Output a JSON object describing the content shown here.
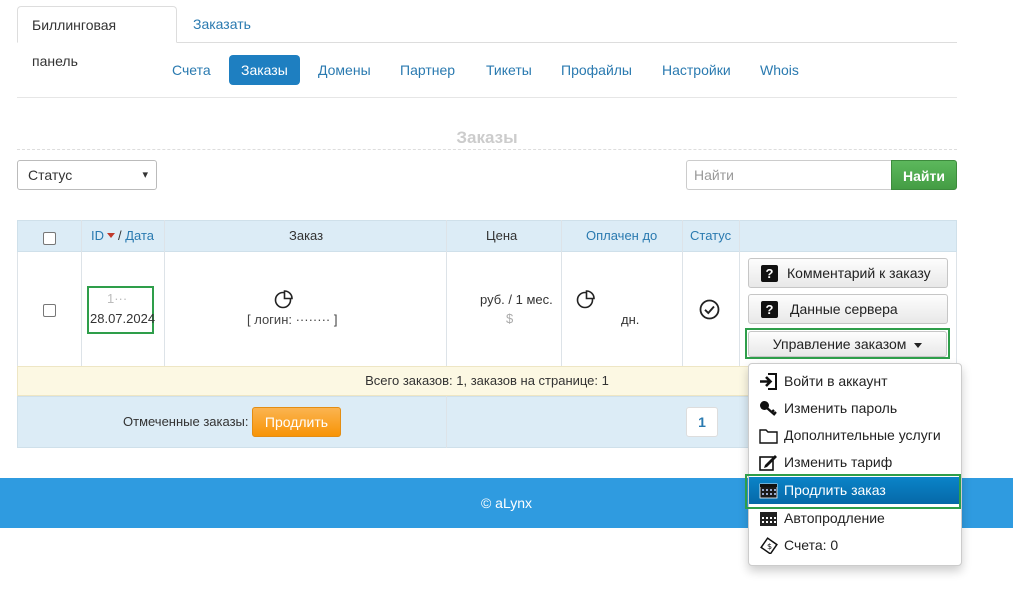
{
  "top_tabs": {
    "active": "Биллинговая панель",
    "link": "Заказать"
  },
  "nav": [
    "Счета",
    "Заказы",
    "Домены",
    "Партнер",
    "Тикеты",
    "Профайлы",
    "Настройки",
    "Whois"
  ],
  "section_title": "Заказы",
  "filter": {
    "status_value": "Статус",
    "search_placeholder": "Найти",
    "search_button": "Найти"
  },
  "table": {
    "headers": {
      "id": "ID",
      "date": "Дата",
      "sep": "/",
      "order": "Заказ",
      "price": "Цена",
      "paid_until": "Оплачен до",
      "status": "Статус"
    },
    "row": {
      "id": "1···",
      "date": "28.07.2024",
      "login": "[ логин: ········ ]",
      "price": "руб. / 1 мес.",
      "price_sub": "$",
      "paid_until": "дн."
    },
    "buttons": {
      "comment": "Комментарий к заказу",
      "server": "Данные сервера",
      "manage": "Управление заказом"
    }
  },
  "summary": "Всего заказов: 1, заказов на странице: 1",
  "footer_row": {
    "marked_label": "Отмеченные заказы:",
    "renew_button": "Продлить",
    "page": "1"
  },
  "footer": "© aLynx",
  "dropdown": [
    {
      "label": "Войти в аккаунт",
      "icon": "login-icon"
    },
    {
      "label": "Изменить пароль",
      "icon": "key-icon"
    },
    {
      "label": "Дополнительные услуги",
      "icon": "folder-icon"
    },
    {
      "label": "Изменить тариф",
      "icon": "edit-icon"
    },
    {
      "label": "Продлить заказ",
      "icon": "calendar-icon"
    },
    {
      "label": "Автопродление",
      "icon": "calendar-icon"
    },
    {
      "label": "Счета: 0",
      "icon": "ticket-icon"
    }
  ],
  "colors": {
    "accent": "#1e7fc1",
    "green": "#5cb85c",
    "orange": "#f89406",
    "footer": "#2f9be0",
    "highlight": "#2e9e4a"
  }
}
